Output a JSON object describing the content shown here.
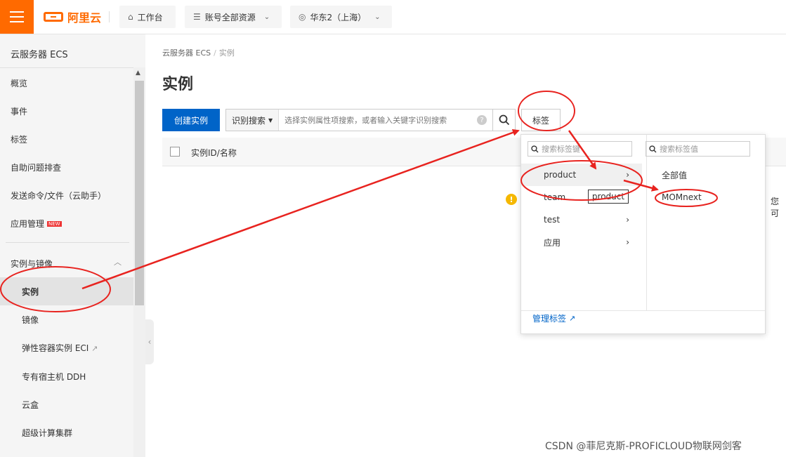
{
  "topbar": {
    "logo_text": "阿里云",
    "workbench_label": "工作台",
    "resources_label": "账号全部资源",
    "region_label": "华东2（上海）"
  },
  "sidebar": {
    "title": "云服务器 ECS",
    "items": [
      "概览",
      "事件",
      "标签",
      "自助问题排查",
      "发送命令/文件（云助手）",
      "应用管理"
    ],
    "new_badge": "NEW",
    "group_label": "实例与镜像",
    "sub_items": [
      "实例",
      "镜像",
      "弹性容器实例 ECI",
      "专有宿主机 DDH",
      "云盒",
      "超级计算集群"
    ]
  },
  "breadcrumb": {
    "root": "云服务器 ECS",
    "current": "实例"
  },
  "page": {
    "title": "实例"
  },
  "toolbar": {
    "create_label": "创建实例",
    "search_type": "识别搜索",
    "search_placeholder": "选择实例属性项搜索，或者输入关键字识别搜索",
    "tag_label": "标签"
  },
  "table": {
    "header_id": "实例ID/名称"
  },
  "empty_text_clip": "您可",
  "tag_dropdown": {
    "key_search_placeholder": "搜索标签键",
    "value_search_placeholder": "搜索标签值",
    "keys": [
      "product",
      "team",
      "test",
      "应用"
    ],
    "values": [
      "全部值",
      "MOMnext"
    ],
    "manage_label": "管理标签",
    "tooltip": "product"
  },
  "watermark": "CSDN @菲尼克斯-PROFICLOUD物联网剑客",
  "colors": {
    "brand": "#ff6a00",
    "primary": "#0064c8",
    "annotation": "#e8231f"
  }
}
